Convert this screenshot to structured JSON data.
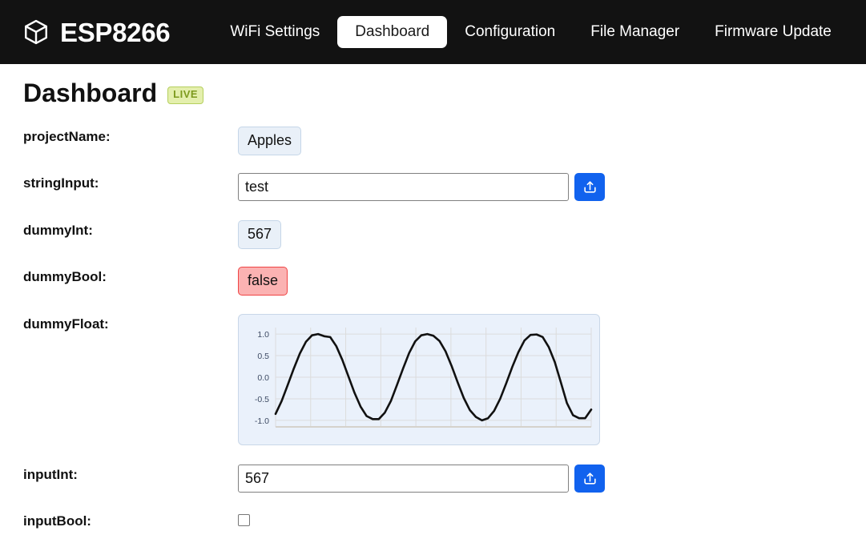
{
  "navbar": {
    "brand": "ESP8266",
    "brand_icon": "cube-icon",
    "links": [
      {
        "label": "WiFi Settings",
        "active": false
      },
      {
        "label": "Dashboard",
        "active": true
      },
      {
        "label": "Configuration",
        "active": false
      },
      {
        "label": "File Manager",
        "active": false
      },
      {
        "label": "Firmware Update",
        "active": false
      }
    ]
  },
  "page": {
    "title": "Dashboard",
    "live_badge": "LIVE"
  },
  "fields": {
    "project_name": {
      "label": "projectName:",
      "value": "Apples"
    },
    "string_input": {
      "label": "stringInput:",
      "value": "test",
      "placeholder": "",
      "upload_icon": "upload-icon"
    },
    "dummy_int": {
      "label": "dummyInt:",
      "value": "567"
    },
    "dummy_bool": {
      "label": "dummyBool:",
      "value": "false"
    },
    "dummy_float": {
      "label": "dummyFloat:"
    },
    "input_int": {
      "label": "inputInt:",
      "value": "567",
      "placeholder": "",
      "upload_icon": "upload-icon"
    },
    "input_bool": {
      "label": "inputBool:",
      "checked": false
    }
  },
  "colors": {
    "navbar_bg": "#121212",
    "accent_blue": "#1162ee",
    "badge_bg": "#e4efad",
    "badge_text": "#7d9a1e",
    "value_bg": "#e9f0f8",
    "danger_bg": "#fbb2b2",
    "chart_bg": "#eaf1fb",
    "chart_line": "#111111"
  },
  "chart_data": {
    "type": "line",
    "title": "",
    "xlabel": "",
    "ylabel": "",
    "ylim": [
      -1.15,
      1.15
    ],
    "yticks": [
      1.0,
      0.5,
      0.0,
      -0.5,
      -1.0
    ],
    "ytick_labels": [
      "1.0",
      "0.5",
      "0.0",
      "-0.5",
      "-1.0"
    ],
    "grid": true,
    "legend": "none",
    "series": [
      {
        "name": "dummyFloat",
        "x": [
          0,
          1,
          2,
          3,
          4,
          5,
          6,
          7,
          8,
          9,
          10,
          11,
          12,
          13,
          14,
          15,
          16,
          17,
          18,
          19,
          20,
          21,
          22,
          23,
          24,
          25,
          26,
          27,
          28,
          29,
          30,
          31,
          32,
          33,
          34,
          35,
          36,
          37,
          38,
          39,
          40,
          41,
          42,
          43,
          44,
          45,
          46,
          47,
          48,
          49
        ],
        "values": [
          -0.85,
          -0.55,
          -0.18,
          0.2,
          0.55,
          0.82,
          0.97,
          1.0,
          0.95,
          0.93,
          0.72,
          0.4,
          0.02,
          -0.36,
          -0.68,
          -0.9,
          -0.97,
          -0.97,
          -0.82,
          -0.55,
          -0.18,
          0.2,
          0.56,
          0.83,
          0.97,
          1.0,
          0.96,
          0.84,
          0.6,
          0.26,
          -0.12,
          -0.48,
          -0.76,
          -0.92,
          -1.0,
          -0.95,
          -0.78,
          -0.5,
          -0.14,
          0.24,
          0.58,
          0.85,
          0.98,
          0.99,
          0.93,
          0.7,
          0.35,
          -0.12,
          -0.6,
          -0.88,
          -0.95,
          -0.95,
          -0.75
        ]
      }
    ]
  }
}
